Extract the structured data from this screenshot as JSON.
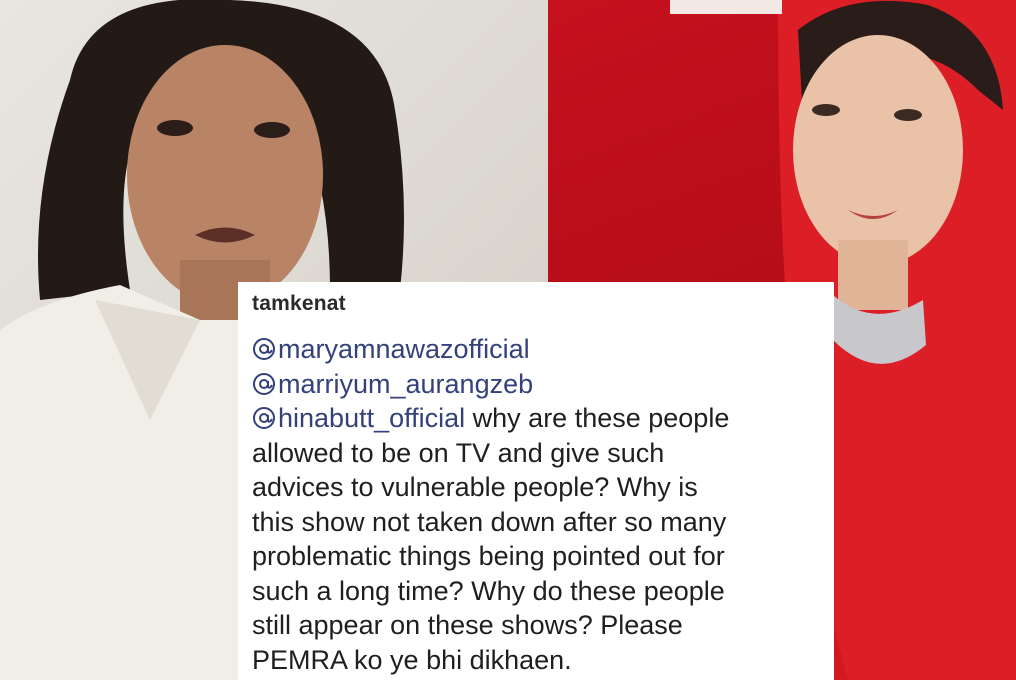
{
  "comment": {
    "username": "tamkenat",
    "mentions": [
      "maryamnawazofficial",
      "marriyum_aurangzeb",
      "hinabutt_official"
    ],
    "text_lines": [
      " why are these people",
      "allowed to be on TV and give such",
      "advices to vulnerable people? Why is",
      "this show not taken down after so many",
      "problematic things being pointed out for",
      "such a long time? Why do these people",
      "still appear on these shows? Please",
      "PEMRA ko ye bhi dikhaen."
    ]
  },
  "icons": {
    "mention": "at-sign-icon"
  },
  "colors": {
    "mention": "#34417a",
    "left_bg": "#e2ded8",
    "right_bg": "#c6101e",
    "card": "#ffffff"
  }
}
